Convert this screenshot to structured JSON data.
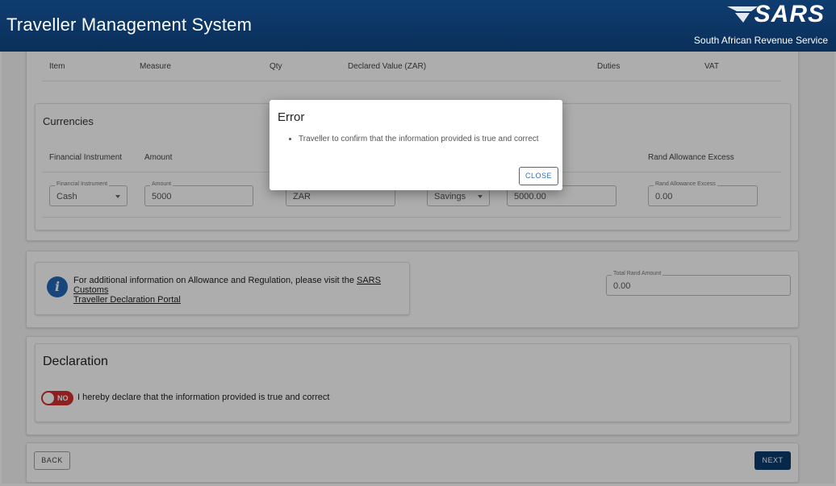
{
  "header": {
    "title": "Traveller Management System",
    "logo_text": "SARS",
    "logo_subtitle": "South African Revenue Service"
  },
  "goods_table": {
    "columns": [
      "Item",
      "Measure",
      "Qty",
      "Declared Value (ZAR)",
      "Duties",
      "VAT"
    ]
  },
  "currencies": {
    "title": "Currencies",
    "columns": [
      "Financial Instrument",
      "Amount",
      "Rand Allowance Excess"
    ],
    "row": {
      "financial_instrument": {
        "label": "Financial Instrument",
        "value": "Cash"
      },
      "amount": {
        "label": "Amount",
        "value": "5000"
      },
      "currency": {
        "value": "ZAR"
      },
      "account_type": {
        "value": "Savings"
      },
      "converted_amount": {
        "value": "5000.00"
      },
      "rand_allowance_excess": {
        "label": "Rand Allowance Excess",
        "value": "0.00"
      }
    }
  },
  "info": {
    "text": "For additional information on Allowance and Regulation, please visit the",
    "link_part1": "SARS Customs",
    "link_part2": "Traveller Declaration Portal",
    "total_rand": {
      "label": "Total Rand Amount",
      "value": "0.00"
    }
  },
  "declaration": {
    "title": "Declaration",
    "toggle_label": "NO",
    "text": "I hereby declare that the information provided is true and correct"
  },
  "footer": {
    "back_label": "BACK",
    "next_label": "NEXT"
  },
  "dialog": {
    "title": "Error",
    "message": "Traveller to confirm that the information provided is true and correct",
    "close_label": "CLOSE"
  },
  "colors": {
    "header_bg": "#0c3b6e",
    "toggle_off": "#d32f2f",
    "primary_button": "#0c3b6e",
    "info_icon": "#2268b9"
  }
}
